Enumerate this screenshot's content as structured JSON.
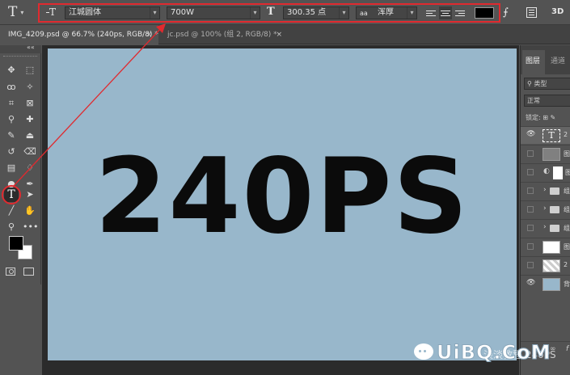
{
  "options_bar": {
    "tool_glyph": "T",
    "font_family": "江城圆体",
    "font_style": "700W",
    "font_size": "300.35 点",
    "antialias_icon_text": "aa",
    "antialias": "浑厚",
    "text_color": "#000000",
    "threed_label": "3D"
  },
  "tabs": [
    {
      "label": "IMG_4209.psd @ 66.7% (240ps, RGB/8) *",
      "close": "×"
    },
    {
      "label": "jc.psd @ 100% (组 2, RGB/8) *",
      "close": "×"
    }
  ],
  "toolbox": {
    "collapse_label": "««",
    "type_tool_glyph": "T",
    "foreground_color": "#000000",
    "background_color": "#ffffff"
  },
  "canvas": {
    "background_color": "#98b7cb",
    "artwork_text": "240PS"
  },
  "layers_panel": {
    "tab_layers": "图层",
    "tab_channels": "通道",
    "filter_label": "类型",
    "blend_mode": "正常",
    "lock_label": "锁定:",
    "layers": [
      {
        "kind": "text",
        "name": "2"
      },
      {
        "kind": "shape",
        "name": "图"
      },
      {
        "kind": "adjustment",
        "name": "图"
      },
      {
        "kind": "group",
        "name": "组"
      },
      {
        "kind": "group",
        "name": "组"
      },
      {
        "kind": "group",
        "name": "组"
      },
      {
        "kind": "image",
        "name": "图"
      },
      {
        "kind": "image",
        "name": "2"
      },
      {
        "kind": "background",
        "name": "背"
      }
    ],
    "footer_fx": "f"
  },
  "annotations": {
    "highlight_color": "#e02a2f"
  },
  "watermark": {
    "text": "UiBQ.CoM",
    "faint_text": "淡淡教程 240PS"
  }
}
